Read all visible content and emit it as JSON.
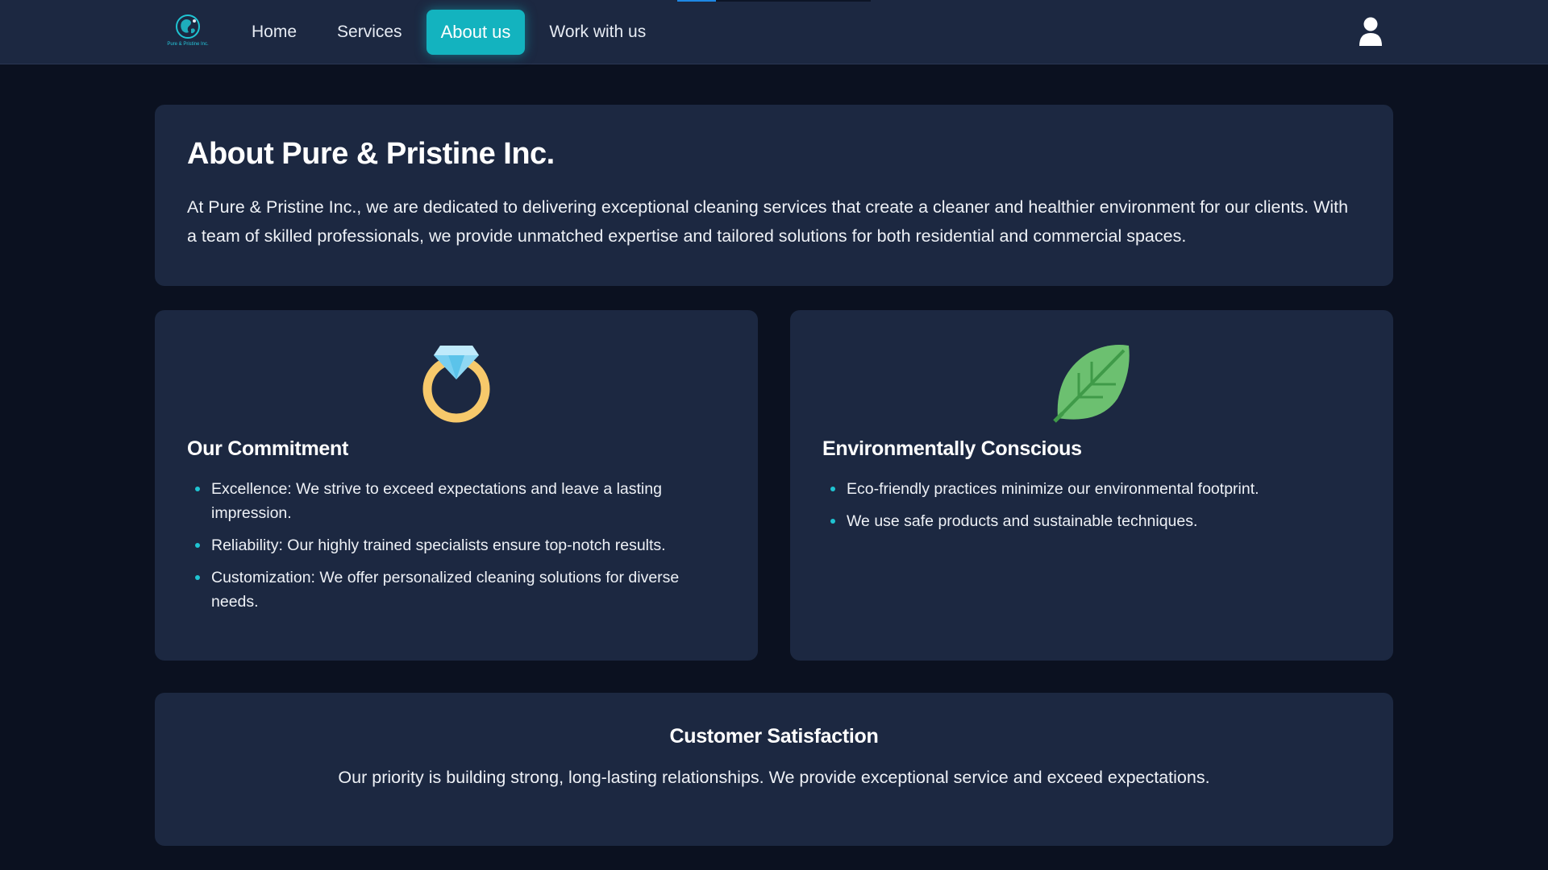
{
  "brand": {
    "logo_text": "Pure & Pristine Inc.",
    "accent_color": "#13b3bf"
  },
  "nav": {
    "items": [
      {
        "label": "Home",
        "active": false
      },
      {
        "label": "Services",
        "active": false
      },
      {
        "label": "About us",
        "active": true
      },
      {
        "label": "Work with us",
        "active": false
      }
    ],
    "user_icon": "user-icon",
    "scroll_progress": 0.2
  },
  "about": {
    "title": "About Pure & Pristine Inc.",
    "text": "At Pure & Pristine Inc., we are dedicated to delivering exceptional cleaning services that create a cleaner and healthier environment for our clients. With a team of skilled professionals, we provide unmatched expertise and tailored solutions for both residential and commercial spaces."
  },
  "commitment": {
    "icon": "diamond-ring-icon",
    "title": "Our Commitment",
    "items": [
      "Excellence: We strive to exceed expectations and leave a lasting impression.",
      "Reliability: Our highly trained specialists ensure top-notch results.",
      "Customization: We offer personalized cleaning solutions for diverse needs."
    ]
  },
  "environment": {
    "icon": "leaf-icon",
    "title": "Environmentally Conscious",
    "items": [
      "Eco-friendly practices minimize our environmental footprint.",
      "We use safe products and sustainable techniques."
    ]
  },
  "satisfaction": {
    "title": "Customer Satisfaction",
    "text": "Our priority is building strong, long-lasting relationships. We provide exceptional service and exceed expectations."
  }
}
